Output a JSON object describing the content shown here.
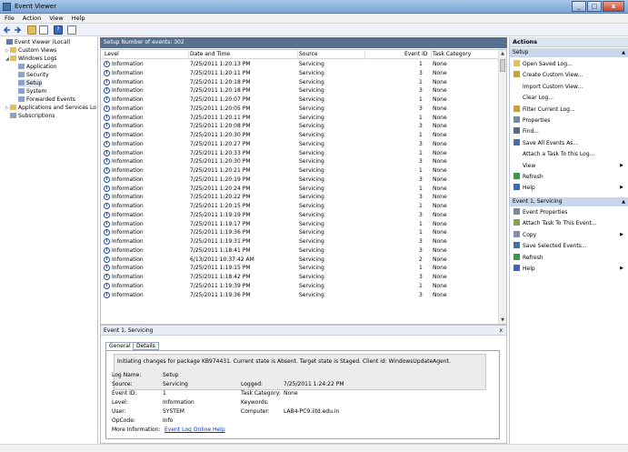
{
  "window": {
    "title": "Event Viewer",
    "minimize_glyph": "_",
    "maximize_glyph": "□",
    "close_glyph": "x"
  },
  "menu": [
    "File",
    "Action",
    "View",
    "Help"
  ],
  "tree": [
    {
      "label": "Event Viewer (Local)",
      "level": 0,
      "expander": ""
    },
    {
      "label": "Custom Views",
      "level": 1,
      "expander": "▷"
    },
    {
      "label": "Windows Logs",
      "level": 1,
      "expander": "◢"
    },
    {
      "label": "Application",
      "level": 2,
      "expander": ""
    },
    {
      "label": "Security",
      "level": 2,
      "expander": ""
    },
    {
      "label": "Setup",
      "level": 2,
      "expander": ""
    },
    {
      "label": "System",
      "level": 2,
      "expander": ""
    },
    {
      "label": "Forwarded Events",
      "level": 2,
      "expander": ""
    },
    {
      "label": "Applications and Services Lo",
      "level": 1,
      "expander": "▷"
    },
    {
      "label": "Subscriptions",
      "level": 1,
      "expander": ""
    }
  ],
  "center_header": "Setup   Number of events: 302",
  "columns": [
    "Level",
    "Date and Time",
    "Source",
    "Event ID",
    "Task Category"
  ],
  "rows": [
    {
      "level": "Information",
      "date": "7/25/2011 1:20:13 PM",
      "source": "Servicing",
      "id": "1",
      "cat": "None"
    },
    {
      "level": "Information",
      "date": "7/25/2011 1:20:11 PM",
      "source": "Servicing",
      "id": "3",
      "cat": "None"
    },
    {
      "level": "Information",
      "date": "7/25/2011 1:20:18 PM",
      "source": "Servicing",
      "id": "1",
      "cat": "None"
    },
    {
      "level": "Information",
      "date": "7/25/2011 1:20:18 PM",
      "source": "Servicing",
      "id": "3",
      "cat": "None"
    },
    {
      "level": "Information",
      "date": "7/25/2011 1:20:07 PM",
      "source": "Servicing",
      "id": "1",
      "cat": "None"
    },
    {
      "level": "Information",
      "date": "7/25/2011 1:20:05 PM",
      "source": "Servicing",
      "id": "3",
      "cat": "None"
    },
    {
      "level": "Information",
      "date": "7/25/2011 1:20:11 PM",
      "source": "Servicing",
      "id": "1",
      "cat": "None"
    },
    {
      "level": "Information",
      "date": "7/25/2011 1:20:08 PM",
      "source": "Servicing",
      "id": "3",
      "cat": "None"
    },
    {
      "level": "Information",
      "date": "7/25/2011 1:20:30 PM",
      "source": "Servicing",
      "id": "1",
      "cat": "None"
    },
    {
      "level": "Information",
      "date": "7/25/2011 1:20:27 PM",
      "source": "Servicing",
      "id": "3",
      "cat": "None"
    },
    {
      "level": "Information",
      "date": "7/25/2011 1:20:33 PM",
      "source": "Servicing",
      "id": "1",
      "cat": "None"
    },
    {
      "level": "Information",
      "date": "7/25/2011 1:20:30 PM",
      "source": "Servicing",
      "id": "3",
      "cat": "None"
    },
    {
      "level": "Information",
      "date": "7/25/2011 1:20:21 PM",
      "source": "Servicing",
      "id": "1",
      "cat": "None"
    },
    {
      "level": "Information",
      "date": "7/25/2011 1:20:19 PM",
      "source": "Servicing",
      "id": "3",
      "cat": "None"
    },
    {
      "level": "Information",
      "date": "7/25/2011 1:20:24 PM",
      "source": "Servicing",
      "id": "1",
      "cat": "None"
    },
    {
      "level": "Information",
      "date": "7/25/2011 1:20:22 PM",
      "source": "Servicing",
      "id": "3",
      "cat": "None"
    },
    {
      "level": "Information",
      "date": "7/25/2011 1:20:15 PM",
      "source": "Servicing",
      "id": "1",
      "cat": "None"
    },
    {
      "level": "Information",
      "date": "7/25/2011 1:19:19 PM",
      "source": "Servicing",
      "id": "3",
      "cat": "None"
    },
    {
      "level": "Information",
      "date": "7/25/2011 1:19:17 PM",
      "source": "Servicing",
      "id": "1",
      "cat": "None"
    },
    {
      "level": "Information",
      "date": "7/25/2011 1:19:36 PM",
      "source": "Servicing",
      "id": "1",
      "cat": "None"
    },
    {
      "level": "Information",
      "date": "7/25/2011 1:19:31 PM",
      "source": "Servicing",
      "id": "3",
      "cat": "None"
    },
    {
      "level": "Information",
      "date": "7/25/2011 1:18:41 PM",
      "source": "Servicing",
      "id": "3",
      "cat": "None"
    },
    {
      "level": "Information",
      "date": "6/13/2011 10:37:42 AM",
      "source": "Servicing",
      "id": "2",
      "cat": "None"
    },
    {
      "level": "Information",
      "date": "7/25/2011 1:19:15 PM",
      "source": "Servicing",
      "id": "1",
      "cat": "None"
    },
    {
      "level": "Information",
      "date": "7/25/2011 1:18:42 PM",
      "source": "Servicing",
      "id": "3",
      "cat": "None"
    },
    {
      "level": "Information",
      "date": "7/25/2011 1:19:39 PM",
      "source": "Servicing",
      "id": "1",
      "cat": "None"
    },
    {
      "level": "Information",
      "date": "7/25/2011 1:19:36 PM",
      "source": "Servicing",
      "id": "3",
      "cat": "None"
    }
  ],
  "detail": {
    "header": "Event 1, Servicing",
    "close_glyph": "x",
    "tabs": [
      "General",
      "Details"
    ],
    "message": "Initiating changes for package KB974431. Current state is Absent. Target state is Staged. Client id: WindowsUpdateAgent.",
    "fields_left": [
      {
        "label": "Log Name:",
        "value": "Setup"
      },
      {
        "label": "Source:",
        "value": "Servicing"
      },
      {
        "label": "Event ID:",
        "value": "1"
      },
      {
        "label": "Level:",
        "value": "Information"
      },
      {
        "label": "User:",
        "value": "SYSTEM"
      },
      {
        "label": "OpCode:",
        "value": "Info"
      },
      {
        "label": "More Information:",
        "value": "Event Log Online Help"
      }
    ],
    "fields_right": [
      {
        "label": "Logged:",
        "value": "7/25/2011 1:24:22 PM"
      },
      {
        "label": "Task Category:",
        "value": "None"
      },
      {
        "label": "Keywords:",
        "value": ""
      },
      {
        "label": "Computer:",
        "value": "LAB4-PC9.iitd.edu.in"
      }
    ]
  },
  "actions": {
    "title": "Actions",
    "section1": "Setup",
    "items1": [
      {
        "label": "Open Saved Log...",
        "icon": "folder-icon",
        "submenu": false
      },
      {
        "label": "Create Custom View...",
        "icon": "filter-icon",
        "submenu": false
      },
      {
        "label": "Import Custom View...",
        "icon": "",
        "submenu": false
      },
      {
        "label": "Clear Log...",
        "icon": "",
        "submenu": false
      },
      {
        "label": "Filter Current Log...",
        "icon": "filter-icon",
        "submenu": false
      },
      {
        "label": "Properties",
        "icon": "properties-icon",
        "submenu": false
      },
      {
        "label": "Find...",
        "icon": "find-icon",
        "submenu": false
      },
      {
        "label": "Save All Events As...",
        "icon": "save-icon",
        "submenu": false
      },
      {
        "label": "Attach a Task To this Log...",
        "icon": "",
        "submenu": false
      },
      {
        "label": "View",
        "icon": "",
        "submenu": true
      },
      {
        "label": "Refresh",
        "icon": "refresh-icon",
        "submenu": false
      },
      {
        "label": "Help",
        "icon": "help-icon",
        "submenu": true
      }
    ],
    "section2": "Event 1, Servicing",
    "items2": [
      {
        "label": "Event Properties",
        "icon": "properties-icon",
        "submenu": false
      },
      {
        "label": "Attach Task To This Event...",
        "icon": "task-icon",
        "submenu": false
      },
      {
        "label": "Copy",
        "icon": "copy-icon",
        "submenu": true
      },
      {
        "label": "Save Selected Events...",
        "icon": "save-icon",
        "submenu": false
      },
      {
        "label": "Refresh",
        "icon": "refresh-icon",
        "submenu": false
      },
      {
        "label": "Help",
        "icon": "help-icon",
        "submenu": true
      }
    ]
  },
  "colors": {
    "header": "#58708f",
    "action_header": "#dde5f1",
    "link": "#0033cc"
  }
}
